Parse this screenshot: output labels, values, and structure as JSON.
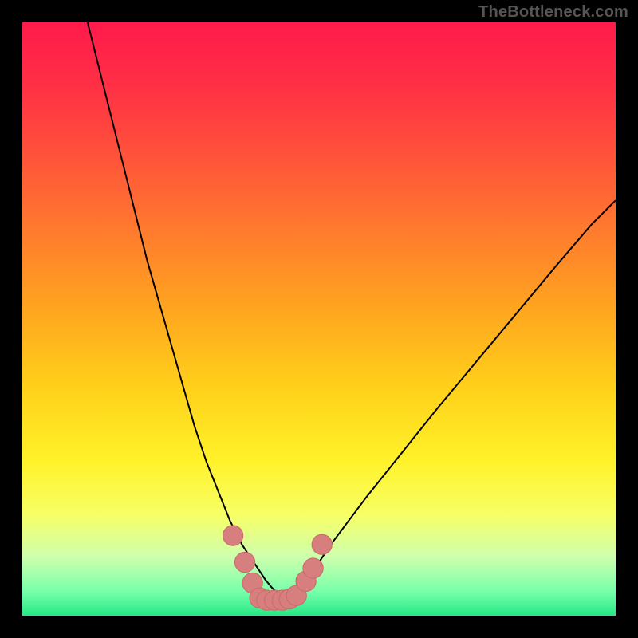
{
  "watermark": {
    "text": "TheBottleneck.com"
  },
  "colors": {
    "bg_black": "#000000",
    "gradient_stops": [
      {
        "offset": 0.0,
        "color": "#ff1a4b"
      },
      {
        "offset": 0.12,
        "color": "#ff3344"
      },
      {
        "offset": 0.3,
        "color": "#ff6a33"
      },
      {
        "offset": 0.48,
        "color": "#ffa41f"
      },
      {
        "offset": 0.62,
        "color": "#ffd21a"
      },
      {
        "offset": 0.74,
        "color": "#fff22a"
      },
      {
        "offset": 0.83,
        "color": "#f7ff66"
      },
      {
        "offset": 0.9,
        "color": "#cfffad"
      },
      {
        "offset": 0.96,
        "color": "#77ffaa"
      },
      {
        "offset": 1.0,
        "color": "#25e886"
      }
    ],
    "curve": "#000000",
    "marker_fill": "#d77e7e",
    "marker_stroke": "#c96a6a"
  },
  "chart_data": {
    "type": "line",
    "title": "",
    "xlabel": "",
    "ylabel": "",
    "xlim": [
      0,
      100
    ],
    "ylim": [
      0,
      100
    ],
    "grid": false,
    "legend": false,
    "curve_x": [
      11,
      13,
      15,
      17,
      19,
      21,
      23,
      25,
      27,
      29,
      31,
      33,
      34,
      35,
      36,
      37,
      38,
      39,
      40,
      41,
      42,
      43,
      44,
      45,
      46,
      47,
      48,
      50,
      52,
      55,
      58,
      62,
      66,
      70,
      75,
      80,
      85,
      90,
      96,
      100
    ],
    "curve_y": [
      100,
      92,
      84,
      76,
      68,
      60,
      53,
      46,
      39,
      32,
      26,
      21,
      18.5,
      16,
      14,
      12,
      10.5,
      9,
      7.5,
      6,
      4.8,
      3.8,
      3,
      2.6,
      3.2,
      4.6,
      6.2,
      9,
      12,
      16,
      20,
      25,
      30,
      35,
      41,
      47,
      53,
      59,
      66,
      70
    ],
    "markers": [
      {
        "x": 35.5,
        "y": 13.5
      },
      {
        "x": 37.5,
        "y": 9.0
      },
      {
        "x": 38.8,
        "y": 5.5
      },
      {
        "x": 40.0,
        "y": 3.0
      },
      {
        "x": 41.2,
        "y": 2.6
      },
      {
        "x": 42.5,
        "y": 2.6
      },
      {
        "x": 43.8,
        "y": 2.6
      },
      {
        "x": 45.0,
        "y": 2.8
      },
      {
        "x": 46.2,
        "y": 3.4
      },
      {
        "x": 47.8,
        "y": 5.8
      },
      {
        "x": 49.0,
        "y": 8.0
      },
      {
        "x": 50.5,
        "y": 12.0
      }
    ],
    "marker_radius_data_units": 1.7
  }
}
